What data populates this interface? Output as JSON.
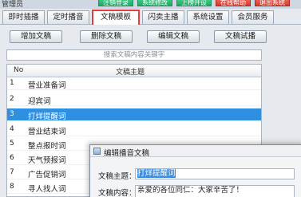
{
  "app": {
    "title": "管理员"
  },
  "top_buttons": [
    {
      "label": "注销登录"
    },
    {
      "label": "系统修改"
    },
    {
      "label": "上榜开设"
    },
    {
      "label": "在线帮助",
      "color": "#d23a2c"
    },
    {
      "label": "退出系统",
      "color": "#d23a2c"
    }
  ],
  "tabs": [
    {
      "label": "即时插播"
    },
    {
      "label": "定时播音"
    },
    {
      "label": "文稿模板",
      "active": true
    },
    {
      "label": "闪卖主播"
    },
    {
      "label": "系统设置"
    },
    {
      "label": "会员服务"
    }
  ],
  "toolbar": {
    "add": "增加文稿",
    "delete": "删除文稿",
    "edit": "编辑文稿",
    "preview": "文稿试播"
  },
  "search": {
    "placeholder": "搜索文稿内容关键字"
  },
  "table": {
    "col_no": "No",
    "col_title": "文稿主题",
    "rows": [
      {
        "no": "1",
        "title": "营业准备词"
      },
      {
        "no": "2",
        "title": "迎宾词"
      },
      {
        "no": "3",
        "title": "打烊提醒词",
        "selected": true
      },
      {
        "no": "4",
        "title": "营业结束词"
      },
      {
        "no": "5",
        "title": "整点报时词"
      },
      {
        "no": "6",
        "title": "天气预报词"
      },
      {
        "no": "7",
        "title": "广告促销词"
      },
      {
        "no": "8",
        "title": "寻人找人词"
      }
    ]
  },
  "dialog": {
    "title": "编辑播音文稿",
    "subject_label": "文稿主题：",
    "subject_value": "打烊提醒词",
    "content_label": "文稿内容：",
    "content_value": "亲爱的各位同仁：大家辛苦了！"
  },
  "colors": {
    "selected_row": "#2f8fe0",
    "active_tab_border": "#e53d3d",
    "top_button": "#1fa866"
  }
}
